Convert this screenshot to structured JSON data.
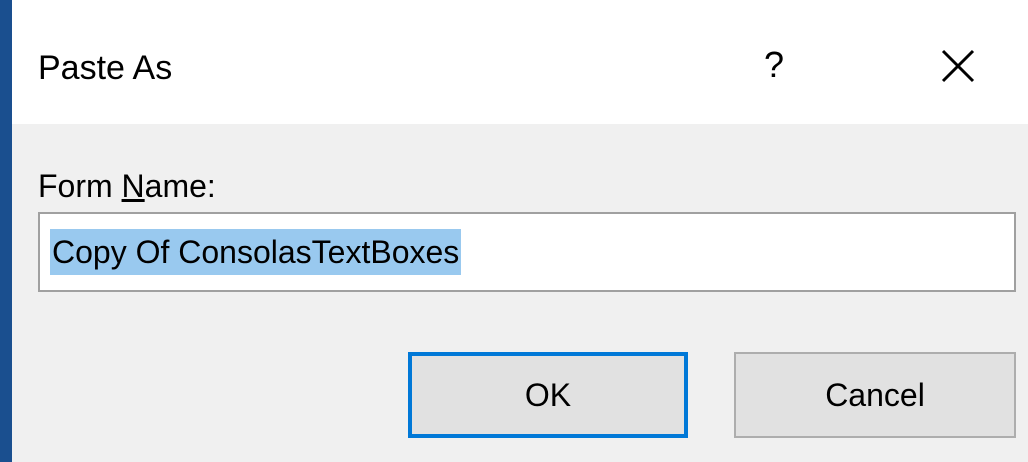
{
  "dialog": {
    "title": "Paste As",
    "help_label": "?",
    "close_icon": "close-icon"
  },
  "form": {
    "label_prefix": "Form ",
    "label_accel": "N",
    "label_suffix": "ame:",
    "name_value": "Copy Of ConsolasTextBoxes"
  },
  "buttons": {
    "ok_label": "OK",
    "cancel_label": "Cancel"
  },
  "colors": {
    "window_frame": "#1a4f8f",
    "selection_highlight": "#99c9ef",
    "default_button_border": "#0078d7"
  }
}
